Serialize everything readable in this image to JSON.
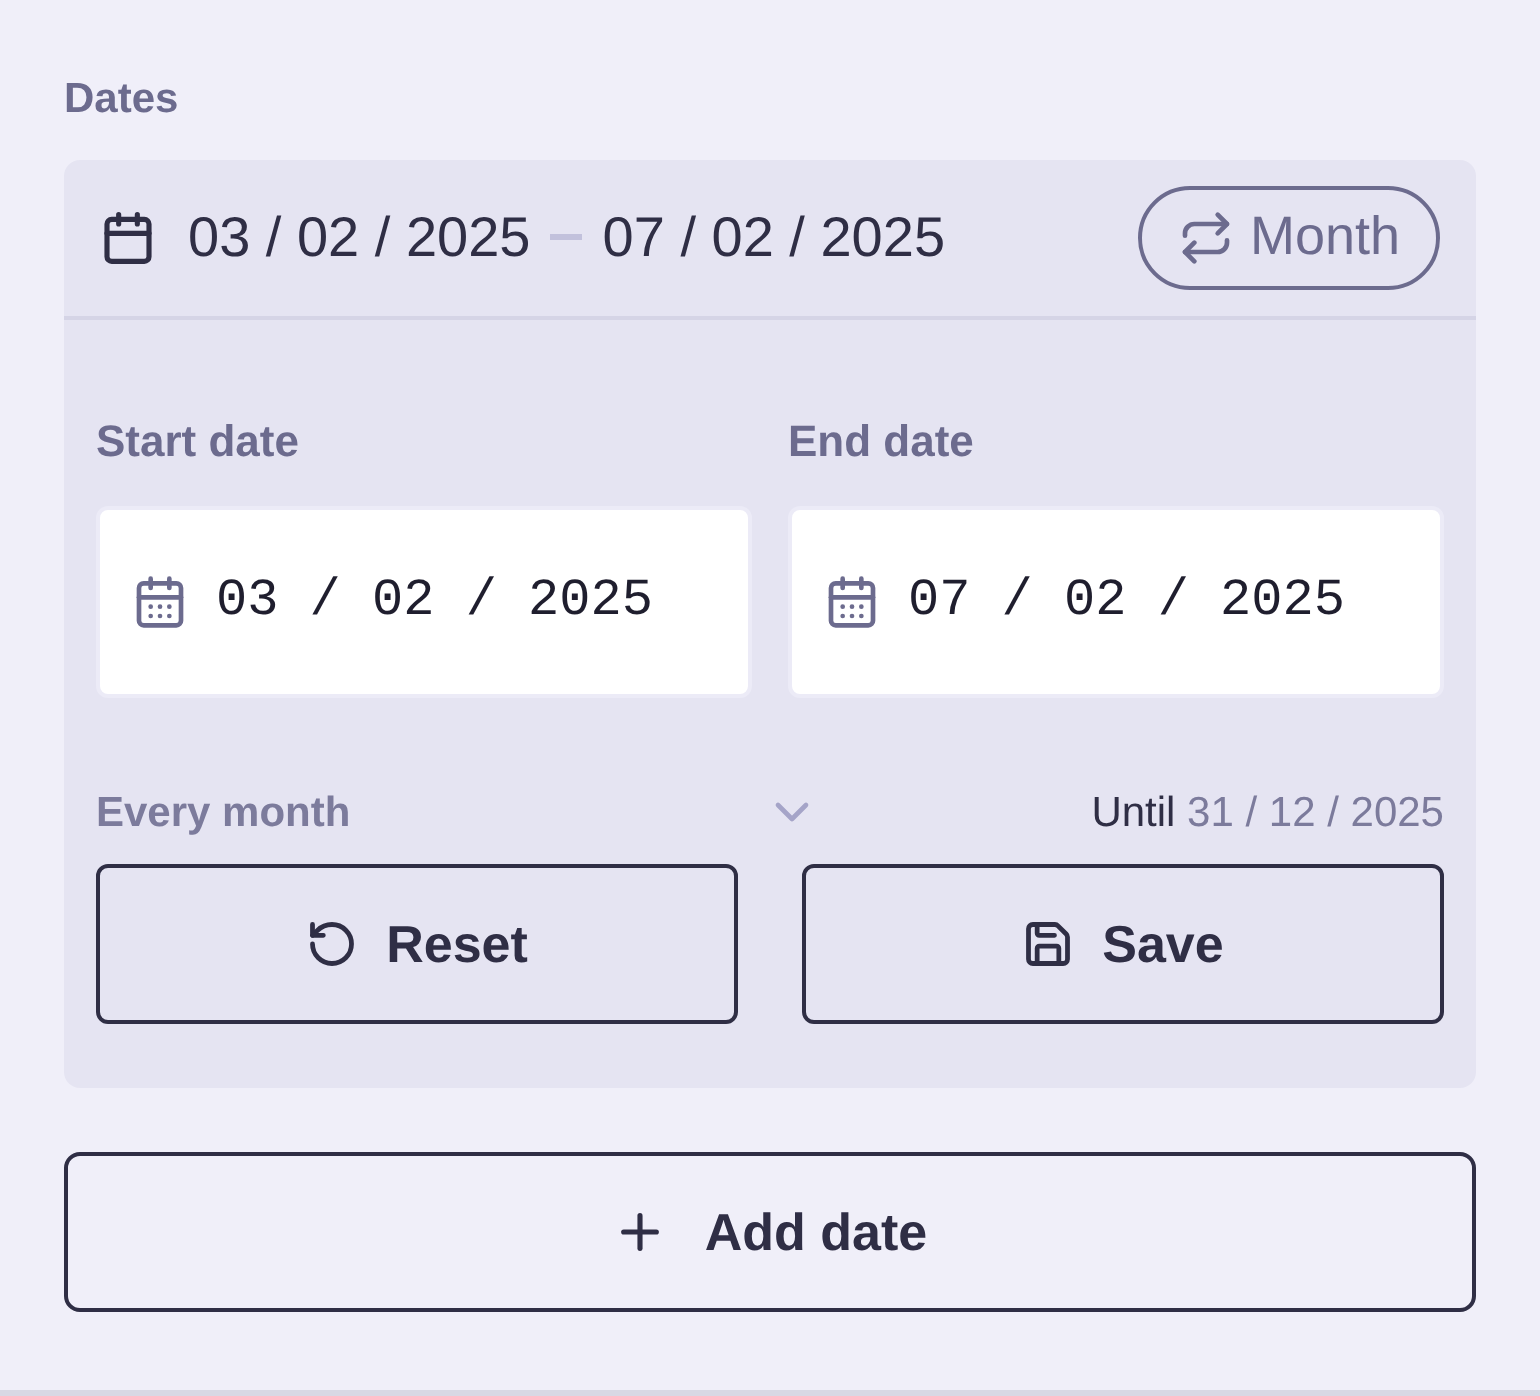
{
  "section_title": "Dates",
  "summary": {
    "start": "03 / 02 / 2025",
    "end": "07 / 02 / 2025",
    "repeat_button": "Month"
  },
  "fields": [
    {
      "label": "Start date",
      "value": "03 / 02 / 2025"
    },
    {
      "label": "End date",
      "value": "07 / 02 / 2025"
    }
  ],
  "recurrence": {
    "value": "Every month",
    "until_label": "Until",
    "until_date": "31 / 12 / 2025"
  },
  "buttons": [
    {
      "kind": "reset",
      "label": "Reset"
    },
    {
      "kind": "save",
      "label": "Save"
    }
  ],
  "add_button": "Add date"
}
